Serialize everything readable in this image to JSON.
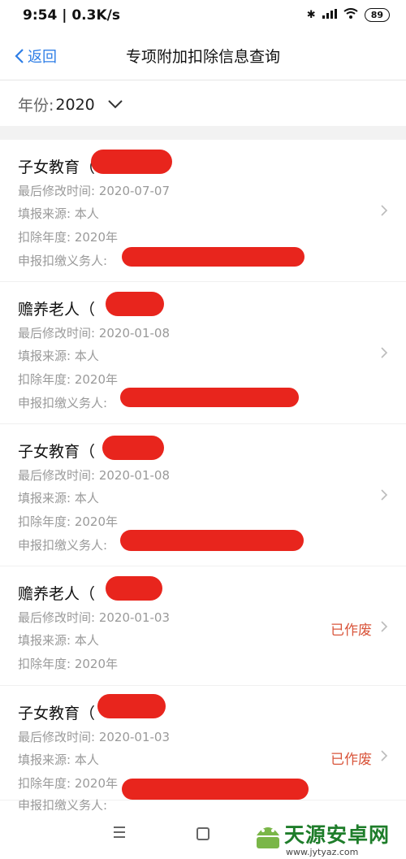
{
  "status": {
    "time": "9:54 | 0.3K/s",
    "battery": "89"
  },
  "nav": {
    "back_label": "返回",
    "title": "专项附加扣除信息查询"
  },
  "filter": {
    "year_label": "年份:",
    "year_value": "2020"
  },
  "records": [
    {
      "title": "子女教育（",
      "modified": "最后修改时间: 2020-07-07",
      "source": "填报来源: 本人",
      "year": "扣除年度: 2020年",
      "withholder": "申报扣缴义务人:",
      "status": ""
    },
    {
      "title": "赡养老人（",
      "modified": "最后修改时间: 2020-01-08",
      "source": "填报来源: 本人",
      "year": "扣除年度: 2020年",
      "withholder": "申报扣缴义务人:",
      "status": ""
    },
    {
      "title": "子女教育（",
      "modified": "最后修改时间: 2020-01-08",
      "source": "填报来源: 本人",
      "year": "扣除年度: 2020年",
      "withholder": "申报扣缴义务人:",
      "status": ""
    },
    {
      "title": "赡养老人（",
      "modified": "最后修改时间: 2020-01-03",
      "source": "填报来源: 本人",
      "year": "扣除年度: 2020年",
      "withholder": "",
      "status": "已作废"
    },
    {
      "title": "子女教育（",
      "modified": "最后修改时间: 2020-01-03",
      "source": "填报来源: 本人",
      "year": "扣除年度: 2020年",
      "withholder": "申报扣缴义务人:",
      "status": "已作废"
    }
  ],
  "watermark": {
    "text": "天源安卓网",
    "url": "www.jytyaz.com"
  },
  "colors": {
    "accent": "#2e7ee6",
    "voided": "#d9553b",
    "redaction": "#e8251d"
  }
}
